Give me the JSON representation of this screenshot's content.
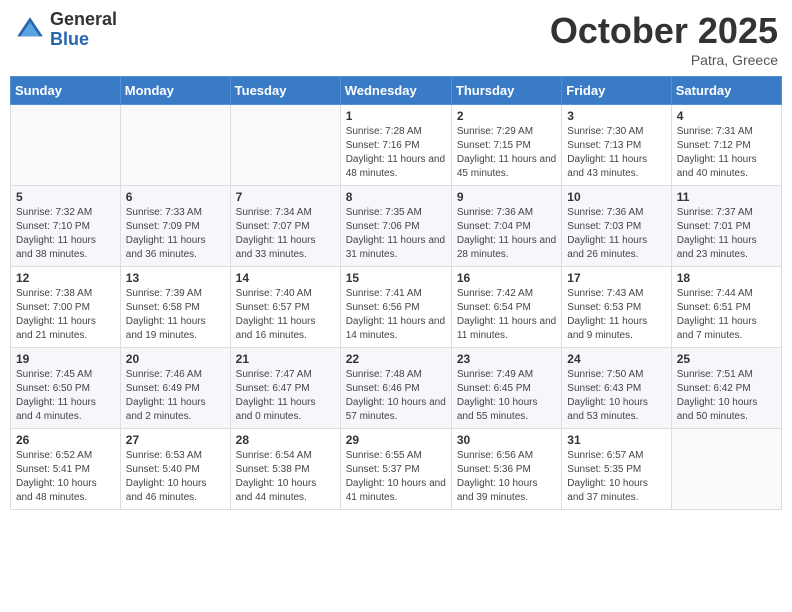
{
  "header": {
    "logo_general": "General",
    "logo_blue": "Blue",
    "month_title": "October 2025",
    "location": "Patra, Greece"
  },
  "days_of_week": [
    "Sunday",
    "Monday",
    "Tuesday",
    "Wednesday",
    "Thursday",
    "Friday",
    "Saturday"
  ],
  "weeks": [
    [
      {
        "day": "",
        "info": ""
      },
      {
        "day": "",
        "info": ""
      },
      {
        "day": "",
        "info": ""
      },
      {
        "day": "1",
        "info": "Sunrise: 7:28 AM\nSunset: 7:16 PM\nDaylight: 11 hours and 48 minutes."
      },
      {
        "day": "2",
        "info": "Sunrise: 7:29 AM\nSunset: 7:15 PM\nDaylight: 11 hours and 45 minutes."
      },
      {
        "day": "3",
        "info": "Sunrise: 7:30 AM\nSunset: 7:13 PM\nDaylight: 11 hours and 43 minutes."
      },
      {
        "day": "4",
        "info": "Sunrise: 7:31 AM\nSunset: 7:12 PM\nDaylight: 11 hours and 40 minutes."
      }
    ],
    [
      {
        "day": "5",
        "info": "Sunrise: 7:32 AM\nSunset: 7:10 PM\nDaylight: 11 hours and 38 minutes."
      },
      {
        "day": "6",
        "info": "Sunrise: 7:33 AM\nSunset: 7:09 PM\nDaylight: 11 hours and 36 minutes."
      },
      {
        "day": "7",
        "info": "Sunrise: 7:34 AM\nSunset: 7:07 PM\nDaylight: 11 hours and 33 minutes."
      },
      {
        "day": "8",
        "info": "Sunrise: 7:35 AM\nSunset: 7:06 PM\nDaylight: 11 hours and 31 minutes."
      },
      {
        "day": "9",
        "info": "Sunrise: 7:36 AM\nSunset: 7:04 PM\nDaylight: 11 hours and 28 minutes."
      },
      {
        "day": "10",
        "info": "Sunrise: 7:36 AM\nSunset: 7:03 PM\nDaylight: 11 hours and 26 minutes."
      },
      {
        "day": "11",
        "info": "Sunrise: 7:37 AM\nSunset: 7:01 PM\nDaylight: 11 hours and 23 minutes."
      }
    ],
    [
      {
        "day": "12",
        "info": "Sunrise: 7:38 AM\nSunset: 7:00 PM\nDaylight: 11 hours and 21 minutes."
      },
      {
        "day": "13",
        "info": "Sunrise: 7:39 AM\nSunset: 6:58 PM\nDaylight: 11 hours and 19 minutes."
      },
      {
        "day": "14",
        "info": "Sunrise: 7:40 AM\nSunset: 6:57 PM\nDaylight: 11 hours and 16 minutes."
      },
      {
        "day": "15",
        "info": "Sunrise: 7:41 AM\nSunset: 6:56 PM\nDaylight: 11 hours and 14 minutes."
      },
      {
        "day": "16",
        "info": "Sunrise: 7:42 AM\nSunset: 6:54 PM\nDaylight: 11 hours and 11 minutes."
      },
      {
        "day": "17",
        "info": "Sunrise: 7:43 AM\nSunset: 6:53 PM\nDaylight: 11 hours and 9 minutes."
      },
      {
        "day": "18",
        "info": "Sunrise: 7:44 AM\nSunset: 6:51 PM\nDaylight: 11 hours and 7 minutes."
      }
    ],
    [
      {
        "day": "19",
        "info": "Sunrise: 7:45 AM\nSunset: 6:50 PM\nDaylight: 11 hours and 4 minutes."
      },
      {
        "day": "20",
        "info": "Sunrise: 7:46 AM\nSunset: 6:49 PM\nDaylight: 11 hours and 2 minutes."
      },
      {
        "day": "21",
        "info": "Sunrise: 7:47 AM\nSunset: 6:47 PM\nDaylight: 11 hours and 0 minutes."
      },
      {
        "day": "22",
        "info": "Sunrise: 7:48 AM\nSunset: 6:46 PM\nDaylight: 10 hours and 57 minutes."
      },
      {
        "day": "23",
        "info": "Sunrise: 7:49 AM\nSunset: 6:45 PM\nDaylight: 10 hours and 55 minutes."
      },
      {
        "day": "24",
        "info": "Sunrise: 7:50 AM\nSunset: 6:43 PM\nDaylight: 10 hours and 53 minutes."
      },
      {
        "day": "25",
        "info": "Sunrise: 7:51 AM\nSunset: 6:42 PM\nDaylight: 10 hours and 50 minutes."
      }
    ],
    [
      {
        "day": "26",
        "info": "Sunrise: 6:52 AM\nSunset: 5:41 PM\nDaylight: 10 hours and 48 minutes."
      },
      {
        "day": "27",
        "info": "Sunrise: 6:53 AM\nSunset: 5:40 PM\nDaylight: 10 hours and 46 minutes."
      },
      {
        "day": "28",
        "info": "Sunrise: 6:54 AM\nSunset: 5:38 PM\nDaylight: 10 hours and 44 minutes."
      },
      {
        "day": "29",
        "info": "Sunrise: 6:55 AM\nSunset: 5:37 PM\nDaylight: 10 hours and 41 minutes."
      },
      {
        "day": "30",
        "info": "Sunrise: 6:56 AM\nSunset: 5:36 PM\nDaylight: 10 hours and 39 minutes."
      },
      {
        "day": "31",
        "info": "Sunrise: 6:57 AM\nSunset: 5:35 PM\nDaylight: 10 hours and 37 minutes."
      },
      {
        "day": "",
        "info": ""
      }
    ]
  ]
}
